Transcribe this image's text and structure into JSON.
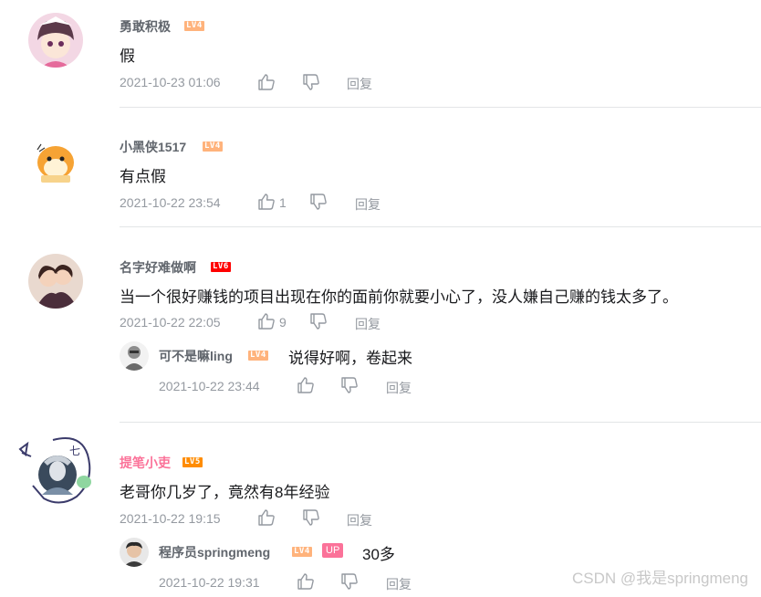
{
  "comments": [
    {
      "user": "勇敢积极",
      "level": "LV4",
      "text": "假",
      "time": "2021-10-23 01:06",
      "likes": "",
      "reply_label": "回复"
    },
    {
      "user": "小黑侠1517",
      "level": "LV4",
      "text": "有点假",
      "time": "2021-10-22 23:54",
      "likes": "1",
      "reply_label": "回复"
    },
    {
      "user": "名字好难做啊",
      "level": "LV6",
      "text": "当一个很好赚钱的项目出现在你的面前你就要小心了，没人嫌自己赚的钱太多了。",
      "time": "2021-10-22 22:05",
      "likes": "9",
      "reply_label": "回复",
      "sub": {
        "user": "可不是嘛ling",
        "level": "LV4",
        "text": "说得好啊，卷起来",
        "time": "2021-10-22 23:44",
        "reply_label": "回复"
      }
    },
    {
      "user": "提笔小吏",
      "level": "LV5",
      "text": "老哥你几岁了，竟然有8年经验",
      "time": "2021-10-22 19:15",
      "likes": "",
      "reply_label": "回复",
      "sub": {
        "user": "程序员springmeng",
        "level": "LV4",
        "up_tag": "UP",
        "text": "30多",
        "time": "2021-10-22 19:31",
        "reply_label": "回复"
      }
    }
  ],
  "watermark": "CSDN @我是springmeng",
  "colors": {
    "username": "#61666d",
    "vip_username": "#fb7299",
    "meta": "#9499a0",
    "lv4": "#ffb37c",
    "lv5": "#ff8c00",
    "lv6": "#ff0000"
  },
  "icons": [
    "avatar",
    "thumb-up-icon",
    "thumb-down-icon"
  ]
}
